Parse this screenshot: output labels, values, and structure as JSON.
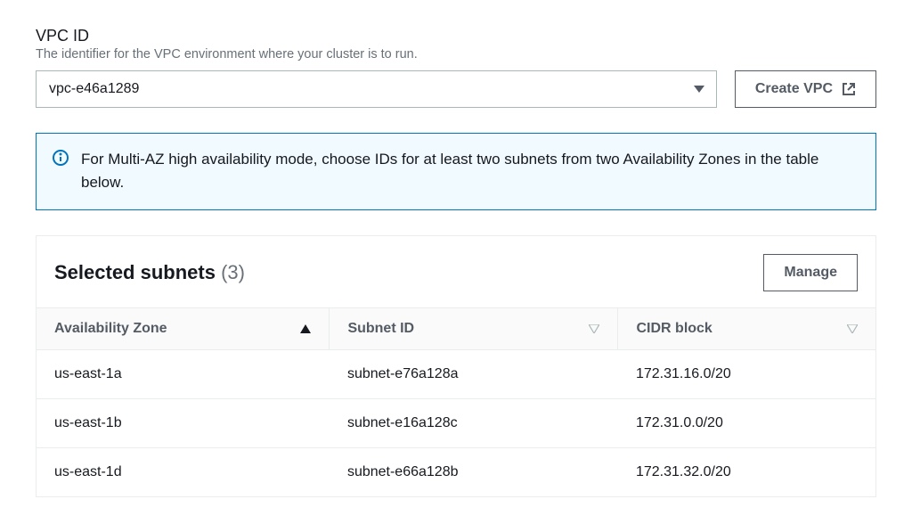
{
  "vpc_field": {
    "label": "VPC ID",
    "help": "The identifier for the VPC environment where your cluster is to run.",
    "value": "vpc-e46a1289",
    "create_button": "Create VPC"
  },
  "info": {
    "message": "For Multi-AZ high availability mode, choose IDs for at least two subnets from two Availability Zones in the table below."
  },
  "subnets_panel": {
    "title": "Selected subnets",
    "count": "(3)",
    "manage_button": "Manage",
    "columns": {
      "az": "Availability Zone",
      "subnet_id": "Subnet ID",
      "cidr": "CIDR block"
    },
    "rows": [
      {
        "az": "us-east-1a",
        "subnet_id": "subnet-e76a128a",
        "cidr": "172.31.16.0/20"
      },
      {
        "az": "us-east-1b",
        "subnet_id": "subnet-e16a128c",
        "cidr": "172.31.0.0/20"
      },
      {
        "az": "us-east-1d",
        "subnet_id": "subnet-e66a128b",
        "cidr": "172.31.32.0/20"
      }
    ]
  }
}
